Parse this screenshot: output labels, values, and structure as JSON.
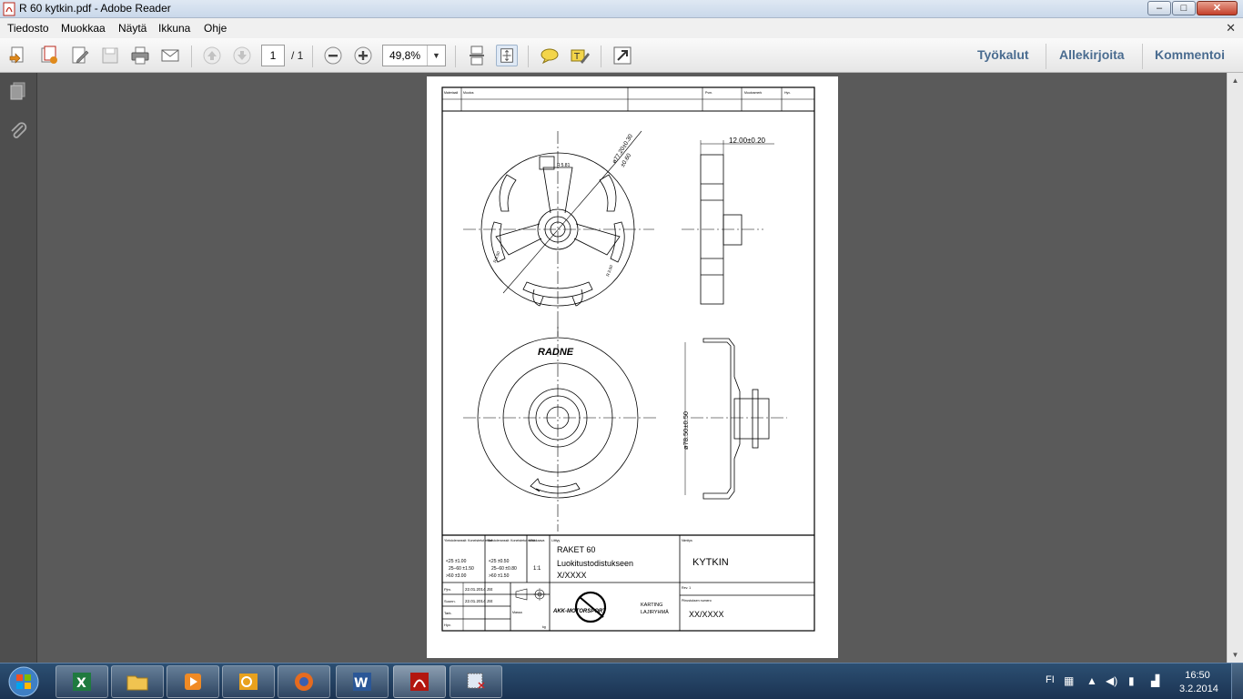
{
  "window": {
    "title": "R 60 kytkin.pdf - Adobe Reader",
    "minimize_label": "–",
    "maximize_label": "□",
    "close_label": "✕"
  },
  "menu": {
    "items": [
      "Tiedosto",
      "Muokkaa",
      "Näytä",
      "Ikkuna",
      "Ohje"
    ],
    "close_doc": "✕"
  },
  "toolbar": {
    "page_current": "1",
    "page_total": "/ 1",
    "zoom": "49,8%",
    "zoom_arrow": "▼",
    "right_tabs": [
      "Työkalut",
      "Allekirjoita",
      "Kommentoi"
    ],
    "icons": [
      "create-pdf-icon",
      "combine-files-icon",
      "edit-icon",
      "save-icon",
      "print-icon",
      "email-icon",
      "previous-page-icon",
      "next-page-icon",
      "zoom-out-icon",
      "zoom-in-icon",
      "scrolling-mode-icon",
      "fit-page-icon",
      "comment-icon",
      "highlight-icon",
      "fullscreen-icon"
    ]
  },
  "navpane": {
    "icons": [
      "page-thumbnails-icon",
      "attachments-icon"
    ]
  },
  "drawing": {
    "header_cells": [
      "Materiaali",
      "Muutos",
      "Pvm.",
      "Muutosmerk",
      "Hyv."
    ],
    "brand": "RADNE",
    "dim_diameter_top": "ø77.20±0.30",
    "dim_diameter_top2": "±0.60",
    "dim_width": "12.00±0.20",
    "dim_diameter_bottom": "ø78.50±0.50",
    "dim_small": [
      "R 5.81",
      "R 3.50",
      "R 3.50"
    ],
    "tol_title": "Yleistoleranssit: Koneistetut mitat",
    "tol_rows": [
      "<25 ±1.00",
      "25–60 ±1.50",
      ">60 ±3.00"
    ],
    "tol2_title": "Yleistoleranssit: Koneistetut mitat",
    "tol2_rows": [
      "<25 ±0.50",
      "25–60 ±0.80",
      ">60 ±1.50"
    ],
    "scale_label": "Mittakaava",
    "scale": "1:1",
    "attachment_label": "Liittyy",
    "title_label": "Nimitys",
    "description_lines": [
      "RAKET 60",
      "Luokitustodistukseen",
      "X/XXXX"
    ],
    "part_name": "KYTKIN",
    "rows": [
      {
        "label": "Pjm.",
        "value": "22.01.2014 JSt"
      },
      {
        "label": "Suunn.",
        "value": "22.01.2014 JSt"
      },
      {
        "label": "Tark.",
        "value": ""
      },
      {
        "label": "Hyv.",
        "value": ""
      }
    ],
    "mass_label": "Massa",
    "mass_unit": "kg",
    "company": "AKK-MOTORSPORT",
    "group_lines": [
      "KARTING",
      "LAJIRYHMÄ"
    ],
    "rev_label": "Rev. 1",
    "drawing_no_label": "Piirustuksen numero",
    "drawing_no": "XX/XXXX"
  },
  "taskbar": {
    "apps": [
      "excel-icon",
      "explorer-icon",
      "media-player-icon",
      "outlook-icon",
      "firefox-icon",
      "word-icon",
      "adobe-reader-icon",
      "snipping-tool-icon"
    ],
    "language": "FI",
    "time": "16:50",
    "date": "3.2.2014"
  },
  "colors": {
    "accent_tabs": "#4a6c90",
    "workspace": "#5a5a5a",
    "taskbar": "#1e3a5c"
  }
}
